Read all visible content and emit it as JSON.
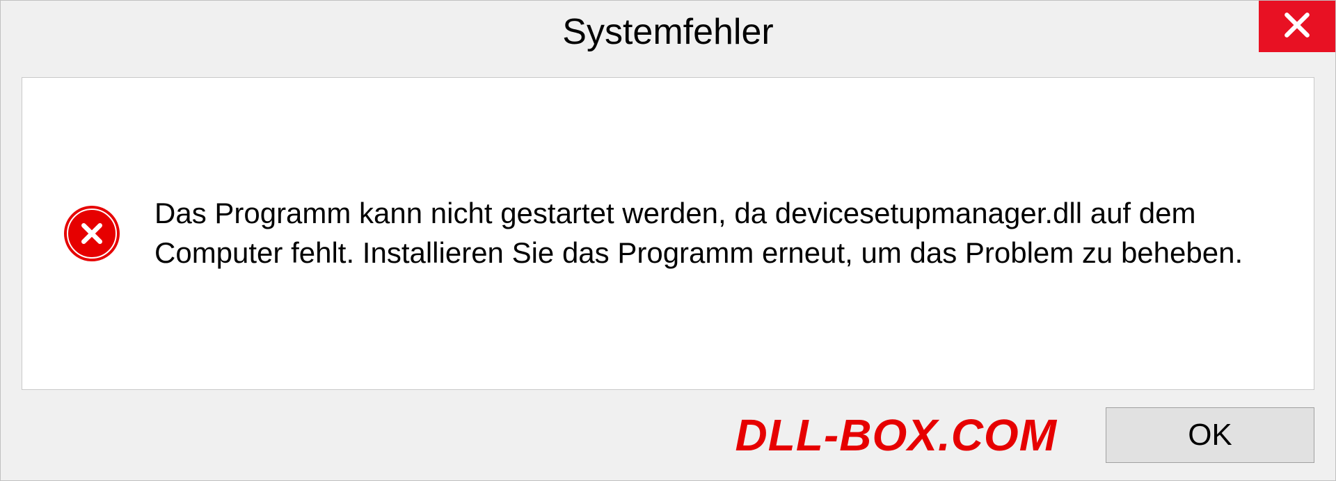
{
  "dialog": {
    "title": "Systemfehler",
    "message": "Das Programm kann nicht gestartet werden, da devicesetupmanager.dll auf dem Computer fehlt. Installieren Sie das Programm erneut, um das Problem zu beheben.",
    "ok_label": "OK"
  },
  "watermark": "DLL-BOX.COM",
  "colors": {
    "close_button": "#e81123",
    "error_icon": "#e60000",
    "watermark": "#e60000"
  }
}
